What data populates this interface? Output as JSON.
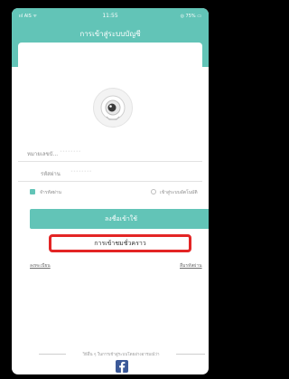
{
  "status_bar": {
    "carrier": "ııl AIS ᯤ",
    "time": "11:55",
    "battery": "◎ 75% ▭"
  },
  "header": {
    "title": "การเข้าสู่ระบบบัญชี"
  },
  "logo": {
    "icon": "camera-mascot-icon"
  },
  "form": {
    "phone_label": "หมายเลขบั...",
    "phone_value": "••••••••",
    "password_label": "รหัสผ่าน",
    "password_value": "••••••••",
    "remember_label": "จำรหัสผ่าน",
    "auto_login_label": "เข้าสู่ระบบอัตโนมัติ",
    "login_button": "ลงชื่อเข้าใช้",
    "guest_button": "การเข้าชมชั่วคราว",
    "register_link": "ลงทะเบียน",
    "forgot_link": "ลืมรหัสผ่าน"
  },
  "social": {
    "divider_text": "วิธีอื่น ๆ ในการเข้าสู่ระบบโดยอ่างอารมณ์ว่า",
    "facebook_icon": "facebook-icon"
  },
  "colors": {
    "accent": "#62c4b7",
    "highlight": "#e32525",
    "facebook": "#3b5998"
  }
}
